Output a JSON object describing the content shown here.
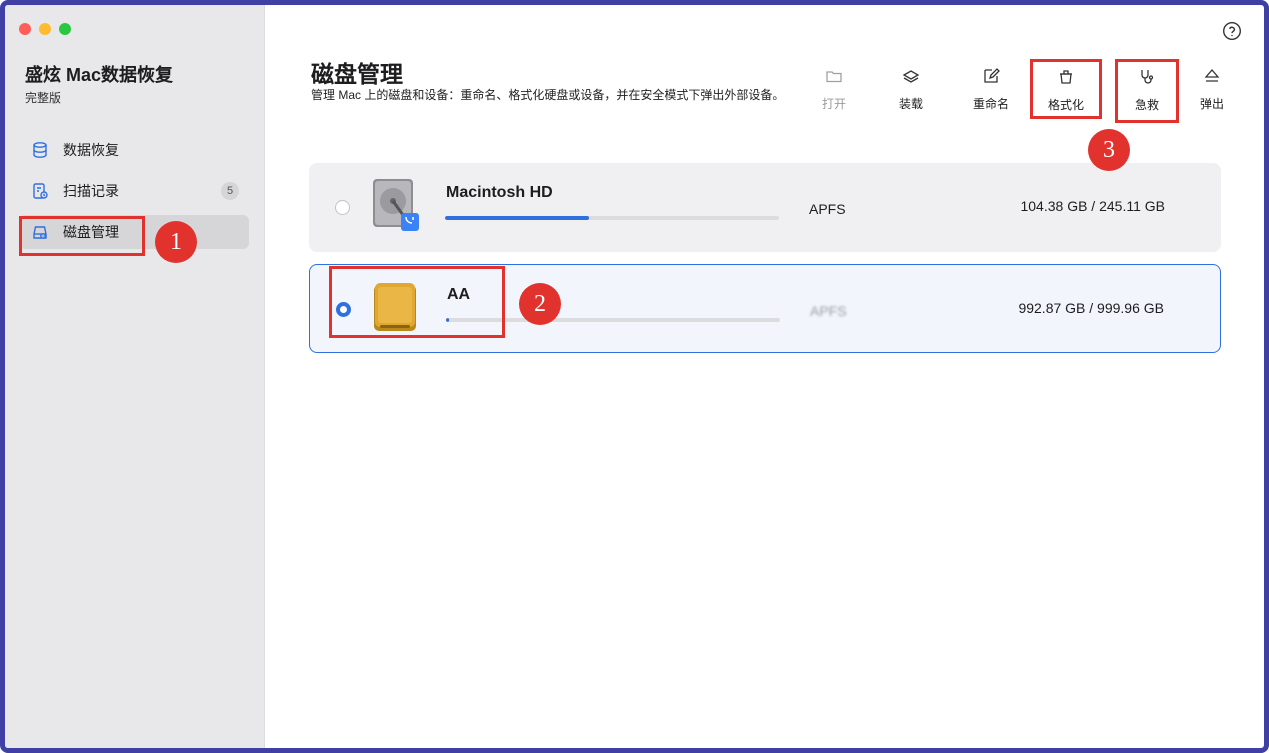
{
  "window": {
    "traffic_lights": [
      "close",
      "minimize",
      "zoom"
    ]
  },
  "sidebar": {
    "app_title": "盛炫 Mac数据恢复",
    "edition": "完整版",
    "items": [
      {
        "label": "数据恢复",
        "icon": "database-icon",
        "badge": ""
      },
      {
        "label": "扫描记录",
        "icon": "scan-history-icon",
        "badge": "5"
      },
      {
        "label": "磁盘管理",
        "icon": "disk-manage-icon",
        "badge": "",
        "active": true
      }
    ]
  },
  "main": {
    "title": "磁盘管理",
    "description": "管理 Mac 上的磁盘和设备：重命名、格式化硬盘或设备，并在安全模式下弹出外部设备。",
    "help_icon": "help-icon",
    "toolbar": [
      {
        "label": "打开",
        "icon": "folder-icon",
        "disabled": true
      },
      {
        "label": "装载",
        "icon": "mount-icon",
        "disabled": false
      },
      {
        "label": "重命名",
        "icon": "rename-icon",
        "disabled": false
      },
      {
        "label": "格式化",
        "icon": "format-icon",
        "disabled": false
      },
      {
        "label": "急救",
        "icon": "first-aid-icon",
        "disabled": false
      },
      {
        "label": "弹出",
        "icon": "eject-icon",
        "disabled": false
      }
    ],
    "disks": [
      {
        "name": "Macintosh HD",
        "filesystem": "APFS",
        "size": "104.38 GB / 245.11 GB",
        "usage": 0.43,
        "selected": false
      },
      {
        "name": "AA",
        "filesystem": "APFS",
        "size": "992.87 GB / 999.96 GB",
        "usage": 0.01,
        "selected": true
      }
    ]
  },
  "annotations": {
    "marker_1": "1",
    "marker_2": "2",
    "marker_3": "3",
    "color": "#e2322d"
  },
  "colors": {
    "accent": "#2f6fe0",
    "sidebar_bg": "#e8e8ea",
    "window_border": "#3f3fa6"
  }
}
